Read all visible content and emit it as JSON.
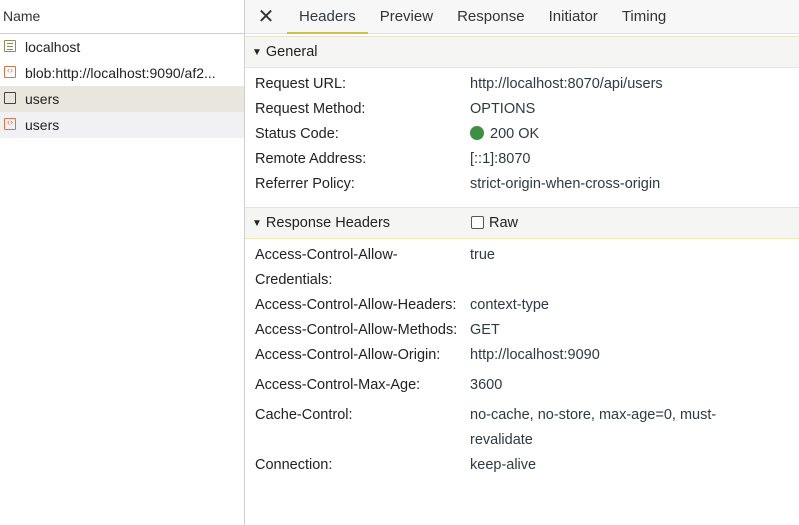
{
  "request_list": {
    "header": "Name",
    "items": [
      {
        "label": "localhost",
        "icon": "document-icon"
      },
      {
        "label": "blob:http://localhost:9090/af2...",
        "icon": "script-icon"
      },
      {
        "label": "users",
        "icon": "blank-file-icon"
      },
      {
        "label": "users",
        "icon": "script-icon"
      }
    ]
  },
  "tabs": {
    "close": "✕",
    "headers": "Headers",
    "preview": "Preview",
    "response": "Response",
    "initiator": "Initiator",
    "timing": "Timing"
  },
  "general": {
    "title": "General",
    "toggle": "▼",
    "rows": [
      {
        "key": "Request URL:",
        "value": "http://localhost:8070/api/users"
      },
      {
        "key": "Request Method:",
        "value": "OPTIONS"
      },
      {
        "key": "Status Code:",
        "value": "200 OK"
      },
      {
        "key": "Remote Address:",
        "value": "[::1]:8070"
      },
      {
        "key": "Referrer Policy:",
        "value": "strict-origin-when-cross-origin"
      }
    ]
  },
  "response_headers": {
    "title": "Response Headers",
    "toggle": "▼",
    "raw_label": "Raw",
    "rows": [
      {
        "key": "Access-Control-Allow-Credentials:",
        "value": "true"
      },
      {
        "key": "Access-Control-Allow-Headers:",
        "value": "context-type"
      },
      {
        "key": "Access-Control-Allow-Methods:",
        "value": "GET"
      },
      {
        "key": "Access-Control-Allow-Origin:",
        "value": "http://localhost:9090"
      },
      {
        "key": "Access-Control-Max-Age:",
        "value": "3600"
      },
      {
        "key": "Cache-Control:",
        "value": "no-cache, no-store, max-age=0, must-revalidate"
      },
      {
        "key": "Connection:",
        "value": "keep-alive"
      }
    ]
  },
  "colors": {
    "status_ok": "#3d8f41",
    "tab_underline": "#d6bc48",
    "selected_row": "#e8e6dd"
  }
}
